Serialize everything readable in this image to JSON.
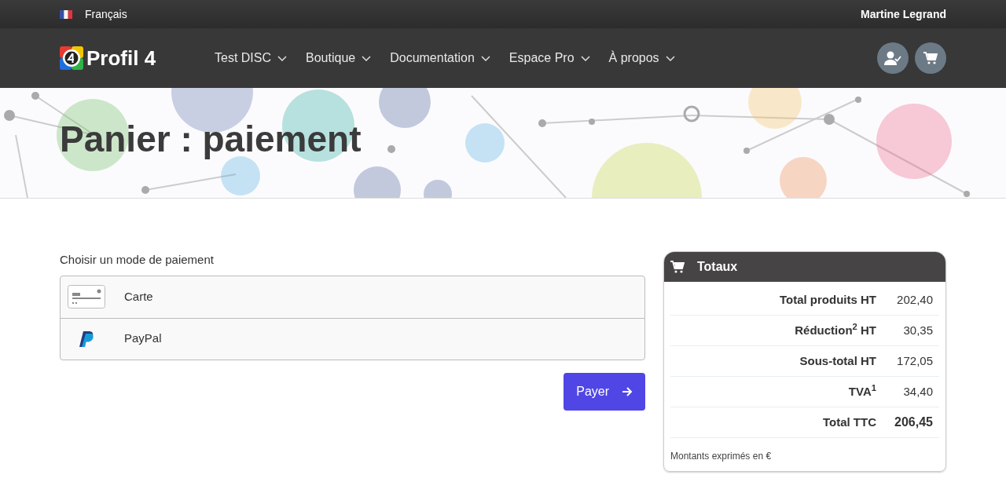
{
  "topbar": {
    "language": "Français",
    "user": "Martine Legrand"
  },
  "navbar": {
    "brand": "Profil 4",
    "menu": [
      {
        "label": "Test DISC"
      },
      {
        "label": "Boutique"
      },
      {
        "label": "Documentation"
      },
      {
        "label": "Espace Pro"
      },
      {
        "label": "À propos"
      }
    ]
  },
  "hero": {
    "title": "Panier : paiement"
  },
  "payment": {
    "prompt": "Choisir un mode de paiement",
    "methods": [
      {
        "kind": "card",
        "label": "Carte"
      },
      {
        "kind": "paypal",
        "label": "PayPal"
      }
    ],
    "submit": "Payer"
  },
  "totals": {
    "title": "Totaux",
    "rows": [
      {
        "label": "Total produits HT",
        "value": "202,40",
        "kind": "line"
      },
      {
        "label": "Réduction$^{2}$ HT",
        "value": "30,35",
        "kind": "line"
      },
      {
        "label": "Sous-total HT",
        "value": "172,05",
        "kind": "line"
      },
      {
        "label": "TVA$^{1}$",
        "value": "34,40",
        "kind": "line"
      },
      {
        "label": "Total TTC",
        "value": "206,45",
        "kind": "total"
      }
    ],
    "note": "Montants exprimés en €"
  }
}
